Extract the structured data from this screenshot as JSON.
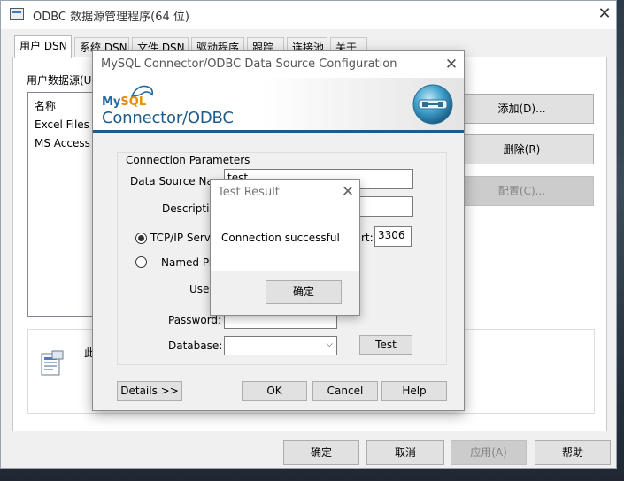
{
  "odbc": {
    "title": "ODBC 数据源管理程序(64 位)",
    "close_glyph": "✕",
    "tabs": [
      "用户 DSN",
      "系统 DSN",
      "文件 DSN",
      "驱动程序",
      "跟踪",
      "连接池",
      "关于"
    ],
    "user_ds_label": "用户数据源(U",
    "list_header": "名称",
    "list_items": [
      "Excel Files",
      "MS Access"
    ],
    "buttons": {
      "add": "添加(D)...",
      "remove": "删除(R)",
      "configure": "配置(C)..."
    },
    "info_text": "此",
    "footer": {
      "ok": "确定",
      "cancel": "取消",
      "apply": "应用(A)",
      "help": "帮助"
    }
  },
  "mysql": {
    "title": "MySQL Connector/ODBC Data Source Configuration",
    "close_glyph": "✕",
    "logo_my": "My",
    "logo_sql": "SQL",
    "logo_product": "Connector/ODBC",
    "group_legend": "Connection Parameters",
    "labels": {
      "dsn": "Data Source Name",
      "description": "Description",
      "tcpip": "TCP/IP Server",
      "port_suffix": "rt:",
      "named_pipe": "Named Pipe",
      "user": "User",
      "password": "Password:",
      "database": "Database:"
    },
    "values": {
      "dsn": "test",
      "description": "",
      "port": "3306",
      "password": "",
      "database": ""
    },
    "selected_connection": "TCP/IP Server",
    "buttons": {
      "test": "Test",
      "details": "Details >>",
      "ok": "OK",
      "cancel": "Cancel",
      "help": "Help"
    }
  },
  "test_result": {
    "title": "Test Result",
    "close_glyph": "✕",
    "message": "Connection successful",
    "ok": "确定"
  }
}
